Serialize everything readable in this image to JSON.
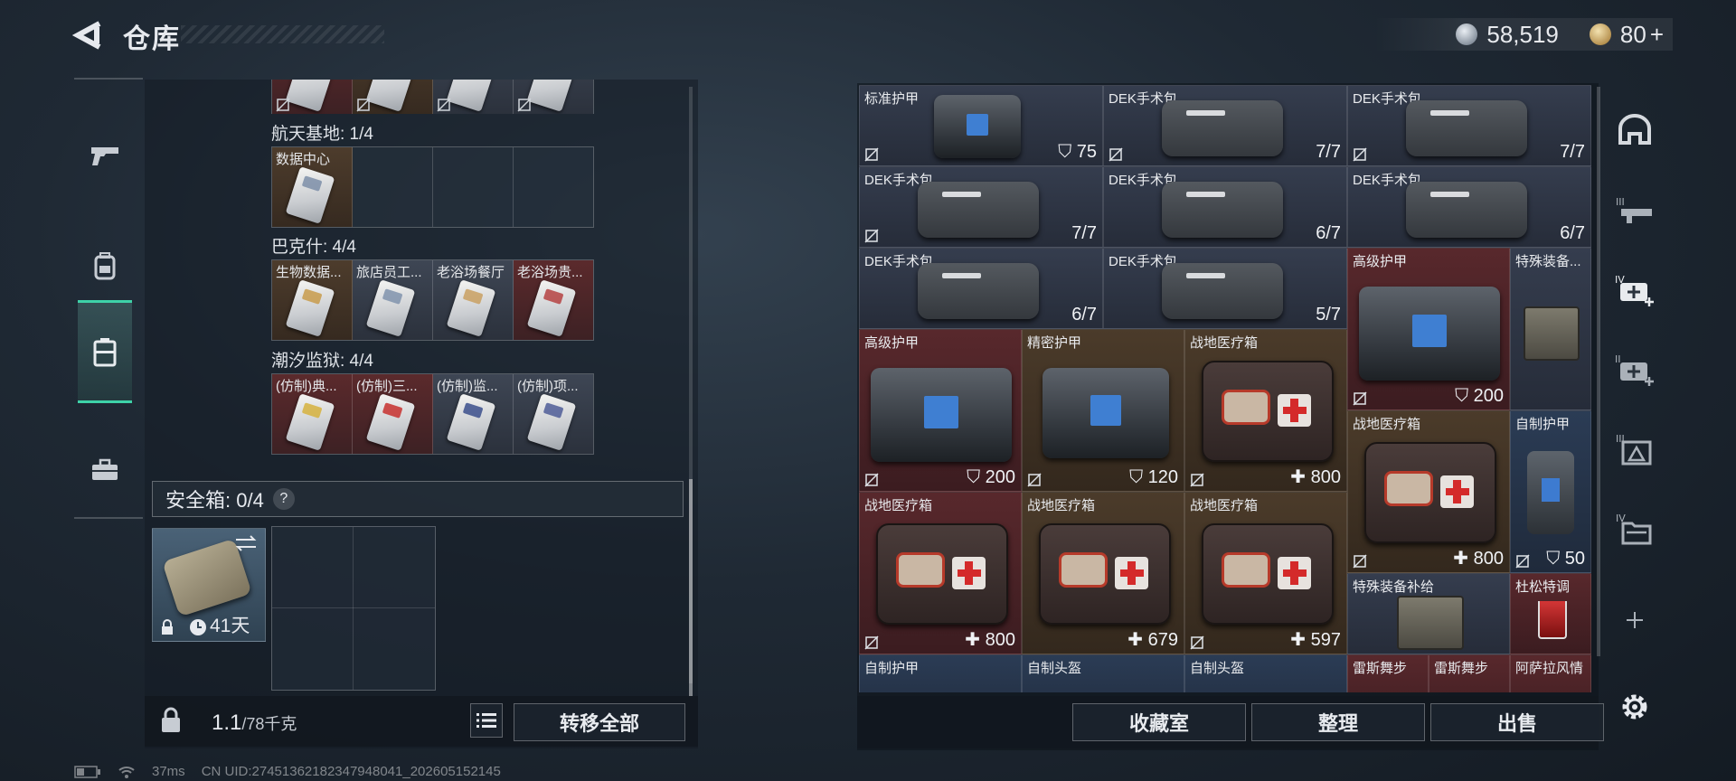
{
  "header": {
    "title": "仓库",
    "silver": "58,519",
    "gold": "80",
    "gold_plus": "+"
  },
  "left_rail": [
    "weapon-icon",
    "backpack-icon",
    "container-icon",
    "briefcase-icon"
  ],
  "collections": {
    "aerospace": {
      "label": "航天基地: 1/4",
      "cells": [
        "数据中心",
        "",
        "",
        ""
      ]
    },
    "bakesh": {
      "label": "巴克什: 4/4",
      "cells": [
        "生物数据...",
        "旅店员工...",
        "老浴场餐厅",
        "老浴场贵..."
      ]
    },
    "tidal_prison": {
      "label": "潮汐监狱: 4/4",
      "cells": [
        "(仿制)典...",
        "(仿制)三...",
        "(仿制)监...",
        "(仿制)项..."
      ]
    }
  },
  "safe_box": {
    "label": "安全箱: 0/4",
    "help": "?",
    "duration": "41天"
  },
  "capacity": {
    "current": "1.1",
    "max": "/78千克"
  },
  "buttons": {
    "transfer_all": "转移全部",
    "collection_room": "收藏室",
    "organize": "整理",
    "sell": "出售"
  },
  "inventory": [
    {
      "name": "标准护甲",
      "value": "75",
      "kind": "armor"
    },
    {
      "name": "DEK手术包",
      "value": "7/7",
      "kind": "kit"
    },
    {
      "name": "DEK手术包",
      "value": "7/7",
      "kind": "kit"
    },
    {
      "name": "DEK手术包",
      "value": "7/7",
      "kind": "kit"
    },
    {
      "name": "DEK手术包",
      "value": "6/7",
      "kind": "kit"
    },
    {
      "name": "DEK手术包",
      "value": "6/7",
      "kind": "kit"
    },
    {
      "name": "DEK手术包",
      "value": "6/7",
      "kind": "kit"
    },
    {
      "name": "DEK手术包",
      "value": "5/7",
      "kind": "kit"
    },
    {
      "name": "高级护甲",
      "value": "200",
      "kind": "armor"
    },
    {
      "name": "特殊装备...",
      "value": "",
      "kind": "case"
    },
    {
      "name": "高级护甲",
      "value": "200",
      "kind": "armor"
    },
    {
      "name": "精密护甲",
      "value": "120",
      "kind": "armor"
    },
    {
      "name": "战地医疗箱",
      "value": "800",
      "kind": "med"
    },
    {
      "name": "战地医疗箱",
      "value": "800",
      "kind": "med"
    },
    {
      "name": "自制护甲",
      "value": "50",
      "kind": "armor"
    },
    {
      "name": "战地医疗箱",
      "value": "800",
      "kind": "med"
    },
    {
      "name": "战地医疗箱",
      "value": "679",
      "kind": "med"
    },
    {
      "name": "战地医疗箱",
      "value": "597",
      "kind": "med"
    },
    {
      "name": "特殊装备补给",
      "value": "",
      "kind": "case"
    },
    {
      "name": "杜松特调",
      "value": "",
      "kind": "drink"
    },
    {
      "name": "自制护甲",
      "value": "",
      "kind": "armor"
    },
    {
      "name": "自制头盔",
      "value": "",
      "kind": "helmet"
    },
    {
      "name": "自制头盔",
      "value": "",
      "kind": "helmet"
    },
    {
      "name": "雷斯舞步",
      "value": "",
      "kind": "misc"
    },
    {
      "name": "雷斯舞步",
      "value": "",
      "kind": "misc"
    },
    {
      "name": "阿萨拉风情",
      "value": "",
      "kind": "misc"
    }
  ],
  "right_rail": [
    "helmet-slot-icon",
    "weapon-tier3-icon",
    "med-tier4-add-icon",
    "med-tier2-add-icon",
    "armor-tier3-icon",
    "folder-tier4-icon",
    "add-icon",
    "settings-icon"
  ],
  "status_bar": {
    "ping": "37ms",
    "uid": "CN UID:27451362182347948041_202605152145"
  }
}
